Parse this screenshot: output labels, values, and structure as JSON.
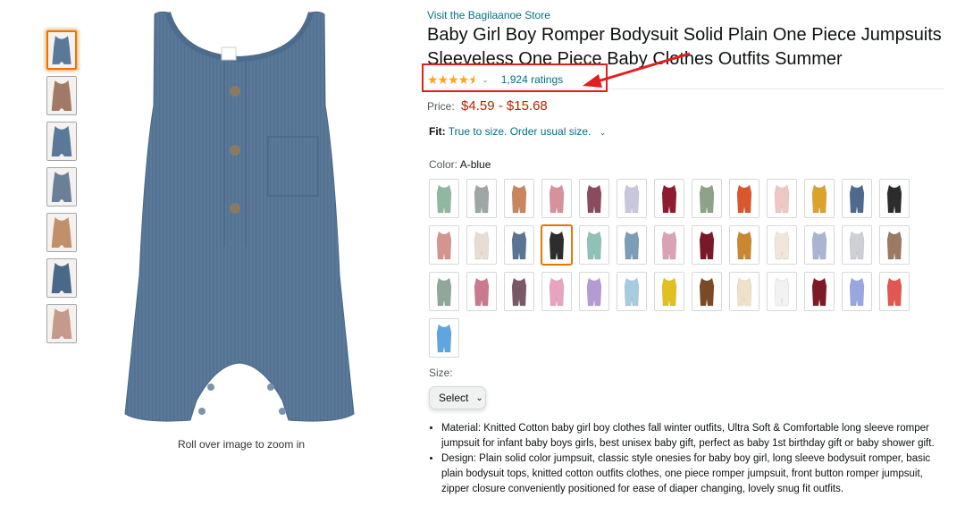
{
  "gallery": {
    "thumbnail_count": 7,
    "zoom_hint": "Roll over image to zoom in"
  },
  "product": {
    "store_link": "Visit the Bagilaanoe Store",
    "title": "Baby Girl Boy Romper Bodysuit Solid Plain One Piece Jumpsuits Sleeveless One Piece Baby Clothes Outfits Summer",
    "rating_stars": 4.5,
    "ratings_text": "1,924 ratings",
    "price_label": "Price:",
    "price_value": "$4.59 - $15.68",
    "fit_label": "Fit:",
    "fit_text": "True to size. Order usual size.",
    "color_label": "Color:",
    "color_value": "A-blue",
    "size_label": "Size:",
    "size_select": "Select",
    "bullets": [
      "Material: Knitted Cotton baby girl boy clothes fall winter outfits, Ultra Soft & Comfortable long sleeve romper jumpsuit for infant baby boys girls, best unisex baby gift, perfect as baby 1st birthday gift or baby shower gift.",
      "Design: Plain solid color jumpsuit, classic style onesies for baby boy girl, long sleeve bodysuit romper, basic plain bodysuit tops, knitted cotton outfits clothes, one piece romper jumpsuit, front button romper jumpsuit, zipper closure conveniently positioned for ease of diaper changing, lovely snug fit outfits."
    ]
  },
  "colors": {
    "brand_link": "#007185",
    "price": "#b12704",
    "star": "#ffa41c",
    "selected_border": "#e77600",
    "annotation": "#e02020"
  },
  "swatch_colors": [
    "#8fb8a0",
    "#9ea7a6",
    "#c7865d",
    "#d7919a",
    "#8b4a5e",
    "#c9c7de",
    "#8d1c2e",
    "#8ea287",
    "#d9572e",
    "#f0c8c3",
    "#dba22c",
    "#4e6a8c",
    "#2c2c2c",
    "#d49590",
    "#e7ddd2",
    "#5a7594",
    "#2d2d2d",
    "#8fc1b7",
    "#7d9cb5",
    "#dba2b5",
    "#7a1828",
    "#c9882f",
    "#f0e6da",
    "#a9b5d3",
    "#cfcfd6",
    "#9b7a63",
    "#8fa89a",
    "#c97a8f",
    "#7a5866",
    "#e7a3bf",
    "#b69bd3",
    "#a8cbe0",
    "#e1c020",
    "#7a4a26",
    "#f0e2c8",
    "#f2f2f2",
    "#7c1a26",
    "#9aa6e0",
    "#e2574f",
    "#5ea6e0"
  ],
  "selected_swatch": 16
}
